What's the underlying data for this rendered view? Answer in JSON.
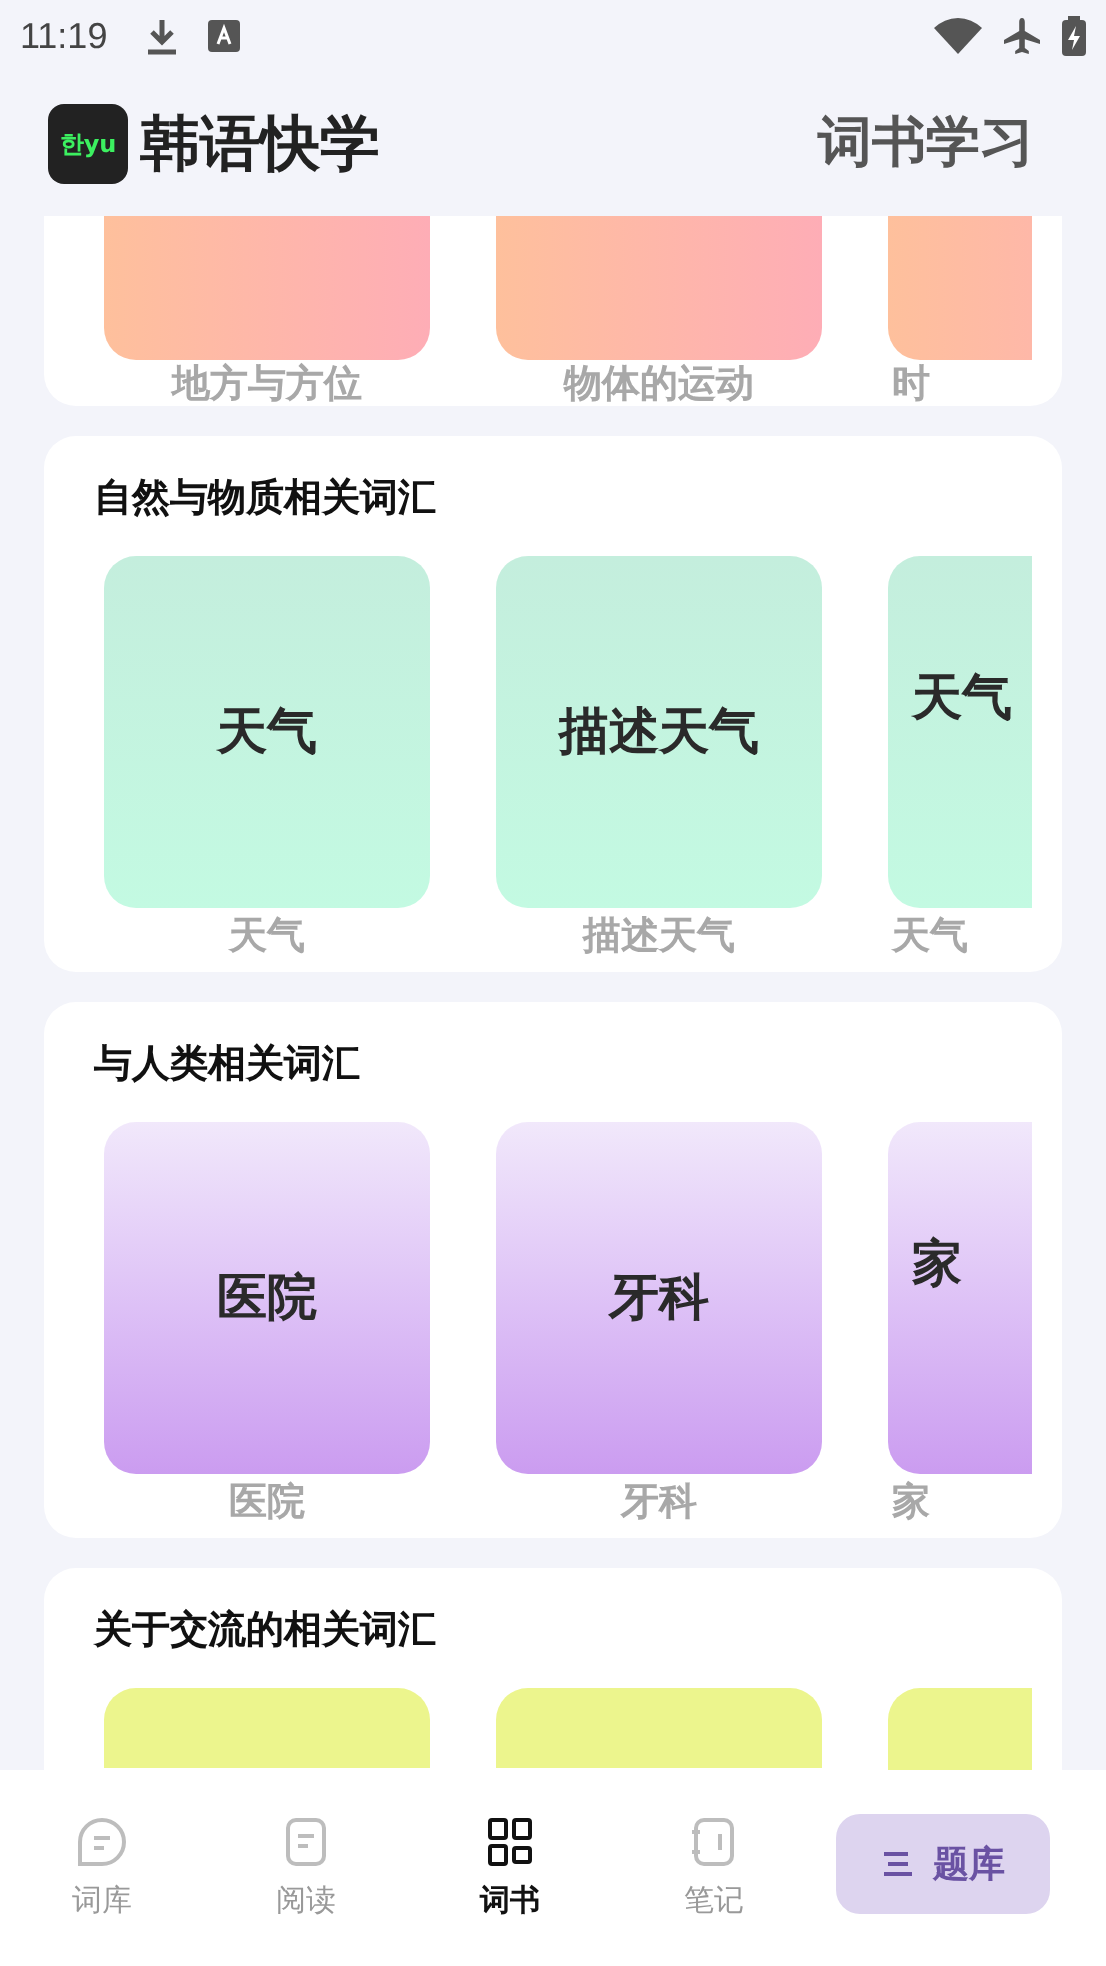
{
  "status_bar": {
    "time": "11:19"
  },
  "header": {
    "logo_text": "한yu",
    "app_name": "韩语快学",
    "page_title": "词书学习"
  },
  "sections": [
    {
      "kind": "peach",
      "cards": [
        {
          "caption": "地方与方位"
        },
        {
          "caption": "物体的运动"
        },
        {
          "caption": "时"
        }
      ]
    },
    {
      "kind": "mint",
      "title": "自然与物质相关词汇",
      "cards": [
        {
          "label": "天气",
          "caption": "天气"
        },
        {
          "label": "描述天气",
          "caption": "描述天气"
        },
        {
          "label": "天气",
          "caption": "天气"
        }
      ]
    },
    {
      "kind": "lavender",
      "title": "与人类相关词汇",
      "cards": [
        {
          "label": "医院",
          "caption": "医院"
        },
        {
          "label": "牙科",
          "caption": "牙科"
        },
        {
          "label": "家",
          "caption": "家"
        }
      ]
    },
    {
      "kind": "lime",
      "title": "关于交流的相关词汇",
      "cards": [
        {
          "kind": "blank"
        },
        {
          "kind": "blank"
        },
        {
          "kind": "blank"
        }
      ]
    }
  ],
  "bottom_nav": {
    "tabs": [
      {
        "label": "词库",
        "selected": false
      },
      {
        "label": "阅读",
        "selected": false
      },
      {
        "label": "词书",
        "selected": true
      },
      {
        "label": "笔记",
        "selected": false
      }
    ],
    "action_button": "题库"
  }
}
